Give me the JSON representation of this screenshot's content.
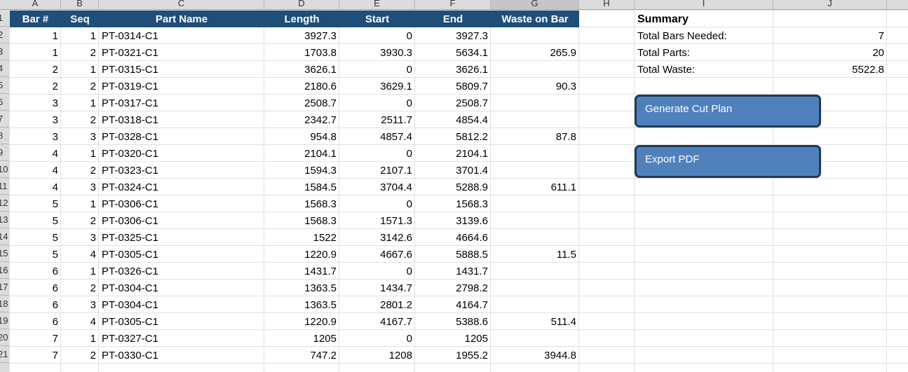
{
  "columns": [
    "A",
    "B",
    "C",
    "D",
    "E",
    "F",
    "G",
    "H",
    "I",
    "J"
  ],
  "row_numbers": [
    "1",
    "2",
    "3",
    "4",
    "5",
    "6",
    "7",
    "8",
    "9",
    "10",
    "11",
    "12",
    "13",
    "14",
    "15",
    "16",
    "17",
    "18",
    "19",
    "20",
    "21"
  ],
  "table": {
    "headers": [
      "Bar #",
      "Seq",
      "Part Name",
      "Length",
      "Start",
      "End",
      "Waste on Bar"
    ],
    "rows": [
      [
        "1",
        "1",
        "PT-0314-C1",
        "3927.3",
        "0",
        "3927.3",
        ""
      ],
      [
        "1",
        "2",
        "PT-0321-C1",
        "1703.8",
        "3930.3",
        "5634.1",
        "265.9"
      ],
      [
        "2",
        "1",
        "PT-0315-C1",
        "3626.1",
        "0",
        "3626.1",
        ""
      ],
      [
        "2",
        "2",
        "PT-0319-C1",
        "2180.6",
        "3629.1",
        "5809.7",
        "90.3"
      ],
      [
        "3",
        "1",
        "PT-0317-C1",
        "2508.7",
        "0",
        "2508.7",
        ""
      ],
      [
        "3",
        "2",
        "PT-0318-C1",
        "2342.7",
        "2511.7",
        "4854.4",
        ""
      ],
      [
        "3",
        "3",
        "PT-0328-C1",
        "954.8",
        "4857.4",
        "5812.2",
        "87.8"
      ],
      [
        "4",
        "1",
        "PT-0320-C1",
        "2104.1",
        "0",
        "2104.1",
        ""
      ],
      [
        "4",
        "2",
        "PT-0323-C1",
        "1594.3",
        "2107.1",
        "3701.4",
        ""
      ],
      [
        "4",
        "3",
        "PT-0324-C1",
        "1584.5",
        "3704.4",
        "5288.9",
        "611.1"
      ],
      [
        "5",
        "1",
        "PT-0306-C1",
        "1568.3",
        "0",
        "1568.3",
        ""
      ],
      [
        "5",
        "2",
        "PT-0306-C1",
        "1568.3",
        "1571.3",
        "3139.6",
        ""
      ],
      [
        "5",
        "3",
        "PT-0325-C1",
        "1522",
        "3142.6",
        "4664.6",
        ""
      ],
      [
        "5",
        "4",
        "PT-0305-C1",
        "1220.9",
        "4667.6",
        "5888.5",
        "11.5"
      ],
      [
        "6",
        "1",
        "PT-0326-C1",
        "1431.7",
        "0",
        "1431.7",
        ""
      ],
      [
        "6",
        "2",
        "PT-0304-C1",
        "1363.5",
        "1434.7",
        "2798.2",
        ""
      ],
      [
        "6",
        "3",
        "PT-0304-C1",
        "1363.5",
        "2801.2",
        "4164.7",
        ""
      ],
      [
        "6",
        "4",
        "PT-0305-C1",
        "1220.9",
        "4167.7",
        "5388.6",
        "511.4"
      ],
      [
        "7",
        "1",
        "PT-0327-C1",
        "1205",
        "0",
        "1205",
        ""
      ],
      [
        "7",
        "2",
        "PT-0330-C1",
        "747.2",
        "1208",
        "1955.2",
        "3944.8"
      ]
    ]
  },
  "summary": {
    "title": "Summary",
    "items": [
      {
        "label": "Total Bars Needed:",
        "value": "7"
      },
      {
        "label": "Total Parts:",
        "value": "20"
      },
      {
        "label": "Total Waste:",
        "value": "5522.8"
      }
    ]
  },
  "buttons": {
    "generate": "Generate Cut Plan",
    "export": "Export PDF"
  },
  "colors": {
    "header_fill": "#1f4e79",
    "button_fill": "#4f81bd",
    "button_border": "#1f3a55"
  }
}
